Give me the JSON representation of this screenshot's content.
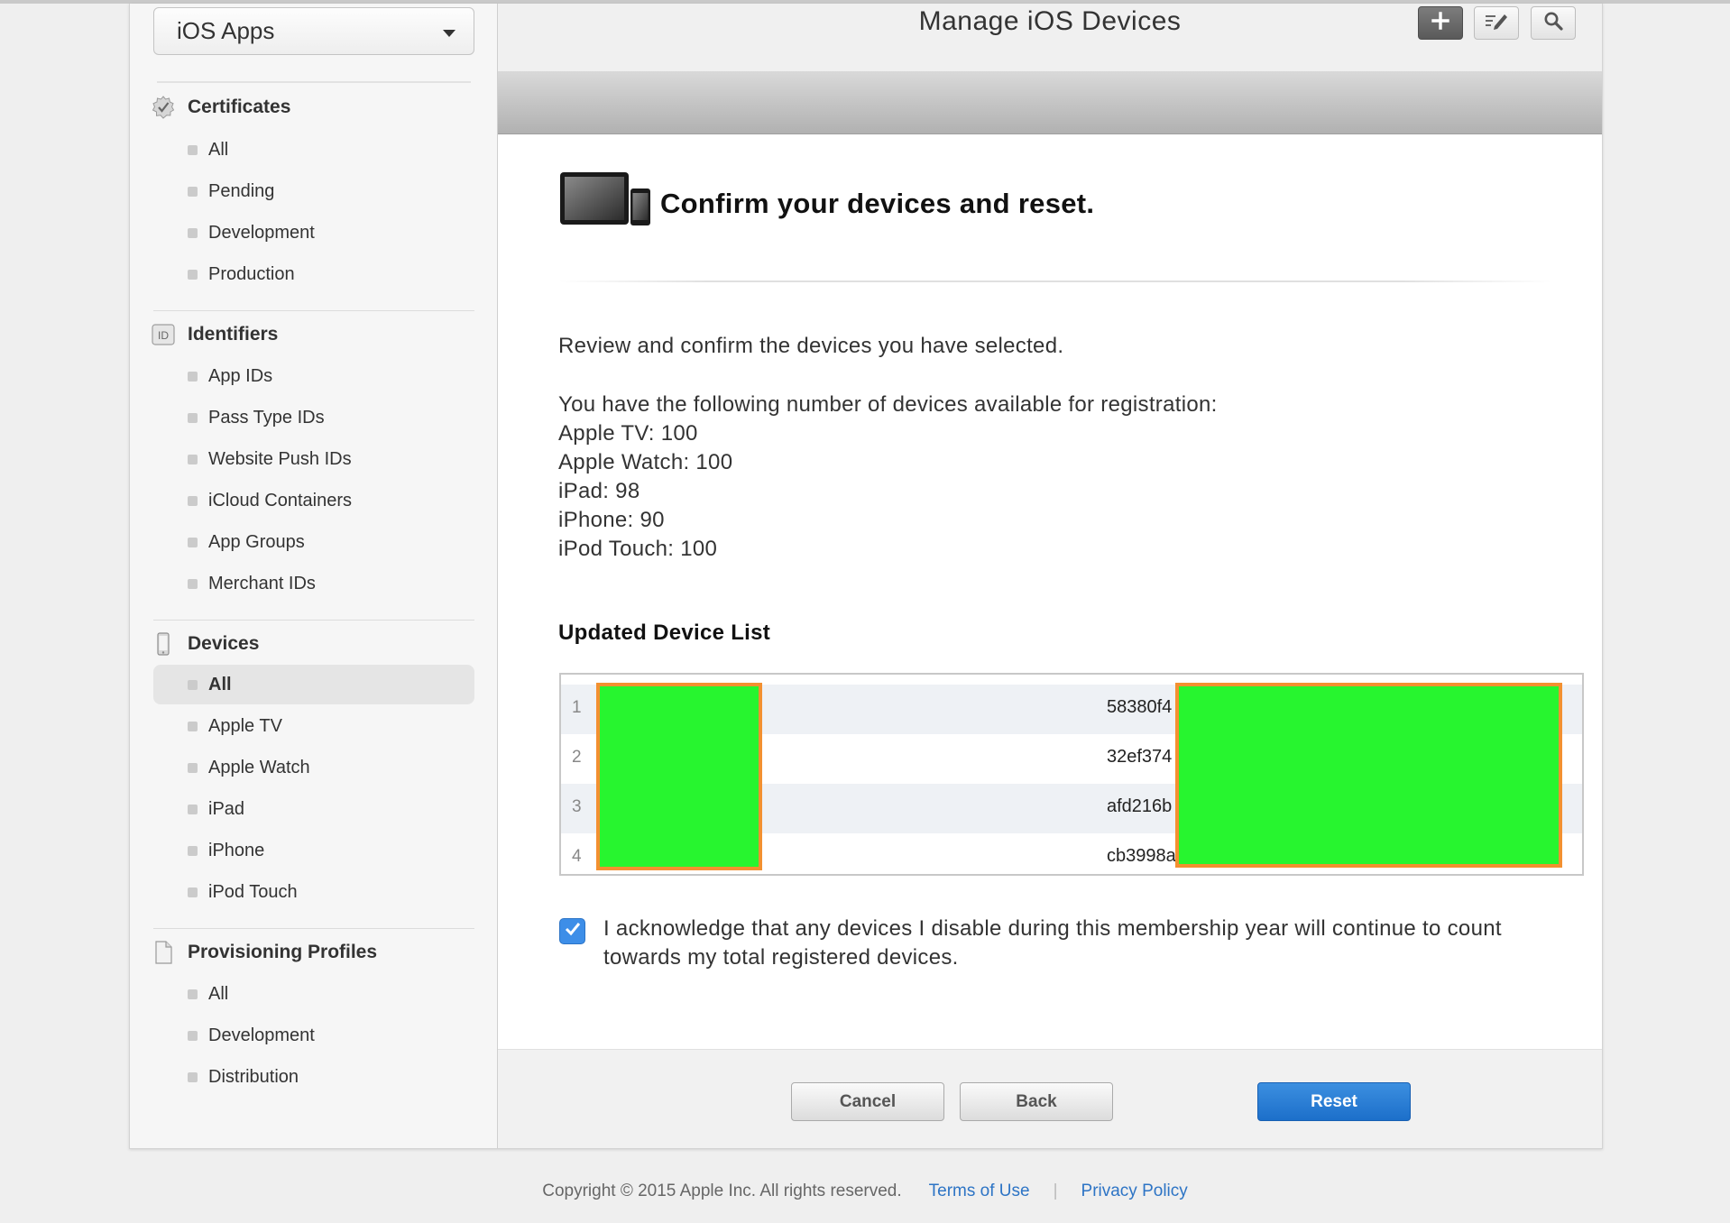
{
  "sidebar": {
    "app_select": "iOS Apps",
    "sections": [
      {
        "title": "Certificates",
        "icon": "certificate-badge-icon",
        "items": [
          "All",
          "Pending",
          "Development",
          "Production"
        ]
      },
      {
        "title": "Identifiers",
        "icon": "id-badge-icon",
        "icon_text": "ID",
        "items": [
          "App IDs",
          "Pass Type IDs",
          "Website Push IDs",
          "iCloud Containers",
          "App Groups",
          "Merchant IDs"
        ]
      },
      {
        "title": "Devices",
        "icon": "phone-device-icon",
        "items": [
          "All",
          "Apple TV",
          "Apple Watch",
          "iPad",
          "iPhone",
          "iPod Touch"
        ],
        "active_item": "All"
      },
      {
        "title": "Provisioning Profiles",
        "icon": "document-icon",
        "items": [
          "All",
          "Development",
          "Distribution"
        ]
      }
    ]
  },
  "header": {
    "title": "Manage iOS Devices",
    "tools": [
      "plus-icon",
      "edit-icon",
      "search-icon"
    ]
  },
  "content": {
    "heading": "Confirm your devices and reset.",
    "review_text": "Review and confirm the devices you have selected.",
    "availability_intro": "You have the following number of devices available for registration:",
    "availability": [
      "Apple TV: 100",
      "Apple Watch: 100",
      "iPad: 98",
      "iPhone: 90",
      "iPod Touch: 100"
    ],
    "list_title": "Updated Device List",
    "devices": [
      {
        "index": "1",
        "udid": "58380f4"
      },
      {
        "index": "2",
        "udid": "32ef374"
      },
      {
        "index": "3",
        "udid": "afd216b"
      },
      {
        "index": "4",
        "udid": "cb3998a"
      }
    ],
    "redaction_color": "#27f52f",
    "redaction_border": "#f39030",
    "acknowledge_checked": true,
    "acknowledge_text": "I acknowledge that any devices I disable during this membership year will continue to count towards my total registered devices."
  },
  "actions": {
    "cancel": "Cancel",
    "back": "Back",
    "reset": "Reset"
  },
  "footer": {
    "copyright": "Copyright © 2015 Apple Inc. All rights reserved.",
    "terms": "Terms of Use",
    "separator": "|",
    "privacy": "Privacy Policy"
  },
  "colors": {
    "accent_blue": "#1c6fca",
    "link_blue": "#2d74c5"
  }
}
